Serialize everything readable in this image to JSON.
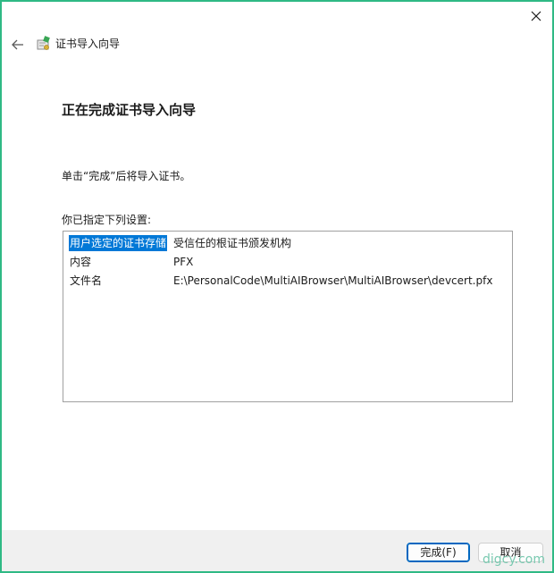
{
  "wizard": {
    "title": "证书导入向导",
    "page_title": "正在完成证书导入向导",
    "instruction": "单击“完成”后将导入证书。",
    "settings_label": "你已指定下列设置:",
    "settings": [
      {
        "key": "用户选定的证书存储",
        "value": "受信任的根证书颁发机构",
        "selected": true
      },
      {
        "key": "内容",
        "value": "PFX",
        "selected": false
      },
      {
        "key": "文件名",
        "value": "E:\\PersonalCode\\MultiAIBrowser\\MultiAIBrowser\\devcert.pfx",
        "selected": false
      }
    ]
  },
  "buttons": {
    "finish": "完成(F)",
    "cancel": "取消"
  },
  "watermark": "digcy.com",
  "icons": {
    "close": "close-icon",
    "back": "back-arrow-icon",
    "wizard": "certificate-icon"
  },
  "colors": {
    "window_border": "#2fb985",
    "selection": "#0078d7",
    "default_button_border": "#0067c0"
  }
}
